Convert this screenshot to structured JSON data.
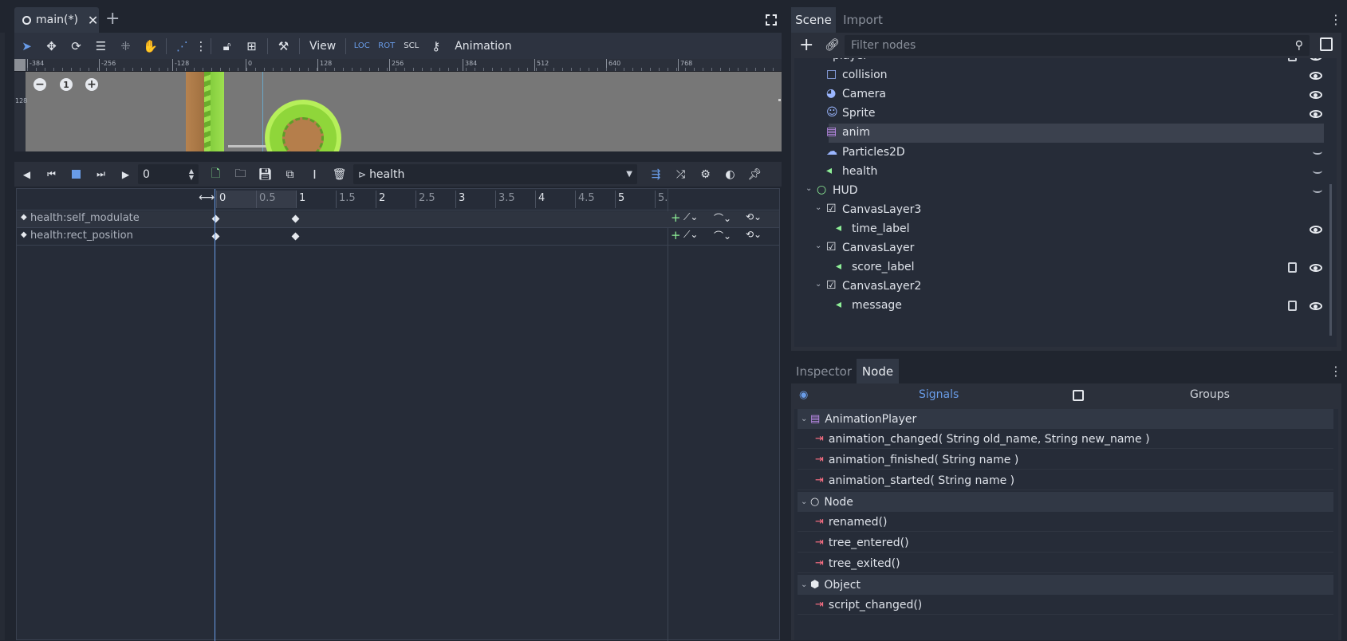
{
  "editor_tab": {
    "title": "main(*)",
    "add_label": "+"
  },
  "viewport_toolbar": {
    "view_label": "View",
    "animation_label": "Animation"
  },
  "ruler_ticks": [
    "-384",
    "-256",
    "-128",
    "0",
    "128",
    "256",
    "384",
    "512",
    "640",
    "768"
  ],
  "ruler_side_tick": "128",
  "zoom": {
    "reset_label": "1"
  },
  "animation": {
    "time_value": "0",
    "current_animation": "health",
    "timeline_ticks": [
      "0",
      "0.5",
      "1",
      "1.5",
      "2",
      "2.5",
      "3",
      "3.5",
      "4",
      "4.5",
      "5",
      "5."
    ],
    "tracks": [
      {
        "name": "health:self_modulate"
      },
      {
        "name": "health:rect_position"
      }
    ]
  },
  "scene_dock": {
    "tabs": [
      "Scene",
      "Import"
    ],
    "filter_placeholder": "Filter nodes",
    "nodes": [
      {
        "name": "player"
      },
      {
        "name": "collision"
      },
      {
        "name": "Camera"
      },
      {
        "name": "Sprite"
      },
      {
        "name": "anim"
      },
      {
        "name": "Particles2D"
      },
      {
        "name": "health"
      },
      {
        "name": "HUD"
      },
      {
        "name": "CanvasLayer3"
      },
      {
        "name": "time_label"
      },
      {
        "name": "CanvasLayer"
      },
      {
        "name": "score_label"
      },
      {
        "name": "CanvasLayer2"
      },
      {
        "name": "message"
      }
    ]
  },
  "node_dock": {
    "tabs": [
      "Inspector",
      "Node"
    ],
    "subtabs": [
      "Signals",
      "Groups"
    ],
    "sections": [
      {
        "title": "AnimationPlayer",
        "signals": [
          "animation_changed( String old_name, String new_name )",
          "animation_finished( String name )",
          "animation_started( String name )"
        ]
      },
      {
        "title": "Node",
        "signals": [
          "renamed()",
          "tree_entered()",
          "tree_exited()"
        ]
      },
      {
        "title": "Object",
        "signals": [
          "script_changed()"
        ]
      }
    ]
  },
  "colors": {
    "accent": "#699ce8",
    "selected_row": "#3b414e",
    "signal_icon": "#ff7085",
    "label_icon": "#8eef97",
    "keyframe": "#e6e9ee"
  }
}
